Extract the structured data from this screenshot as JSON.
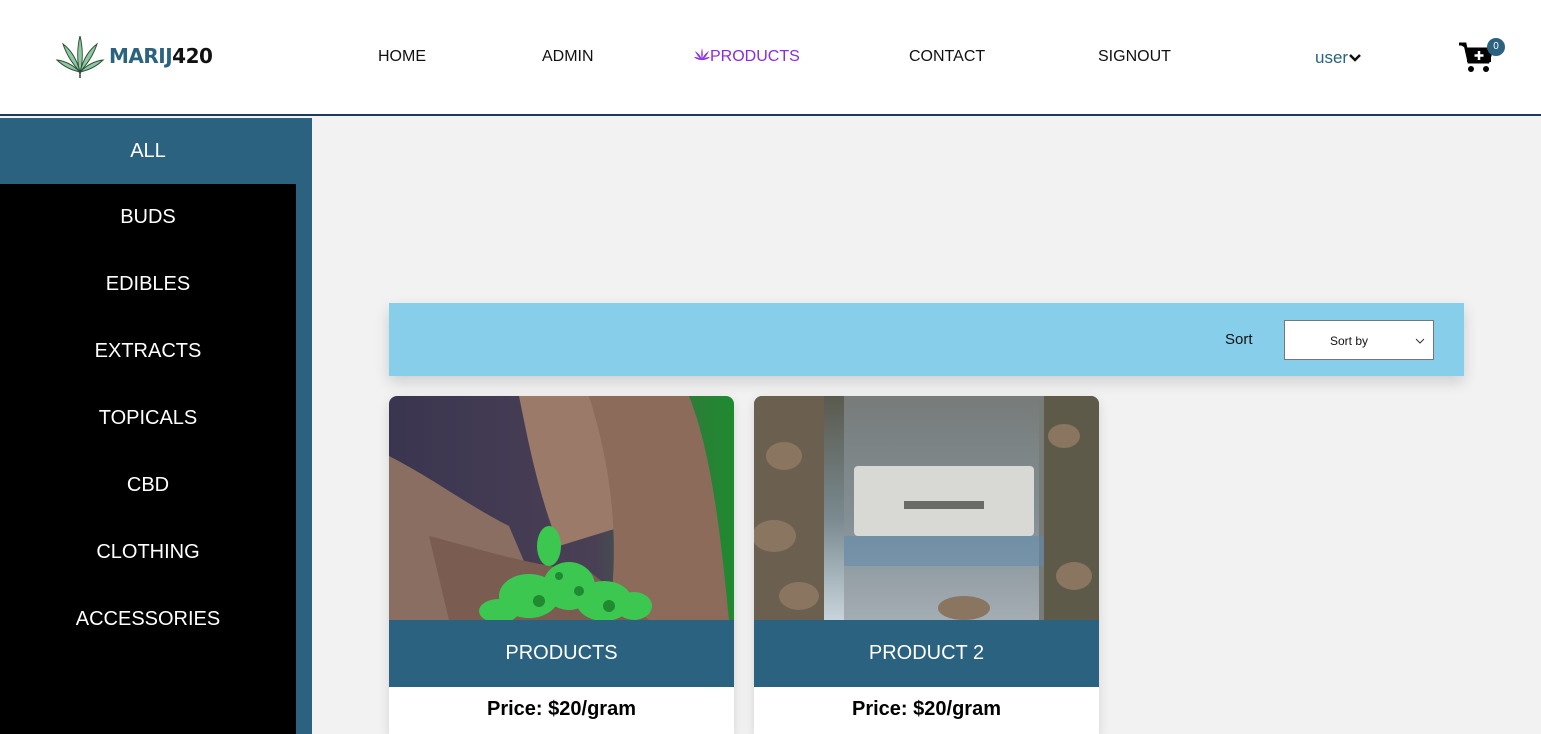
{
  "brand": {
    "part1": "MARIJ",
    "part2": "420"
  },
  "nav": {
    "home": "HOME",
    "admin": "ADMIN",
    "products": "PRODUCTS",
    "contact": "CONTACT",
    "signout": "SIGNOUT"
  },
  "user": {
    "label": "user"
  },
  "cart": {
    "count": "0"
  },
  "sidebar": {
    "items": [
      {
        "label": "ALL"
      },
      {
        "label": "BUDS"
      },
      {
        "label": "EDIBLES"
      },
      {
        "label": "EXTRACTS"
      },
      {
        "label": "TOPICALS"
      },
      {
        "label": "CBD"
      },
      {
        "label": "CLOTHING"
      },
      {
        "label": "ACCESSORIES"
      }
    ]
  },
  "sort": {
    "label": "Sort",
    "selected": "Sort by"
  },
  "products": [
    {
      "title": "PRODUCTS",
      "price": "Price: $20/gram"
    },
    {
      "title": "PRODUCT 2",
      "price": "Price: $20/gram"
    }
  ],
  "colors": {
    "brand_blue": "#2a6280",
    "active_nav": "#8a2be2",
    "sort_bar": "#87ceeb",
    "sidebar_bg": "#000000"
  }
}
